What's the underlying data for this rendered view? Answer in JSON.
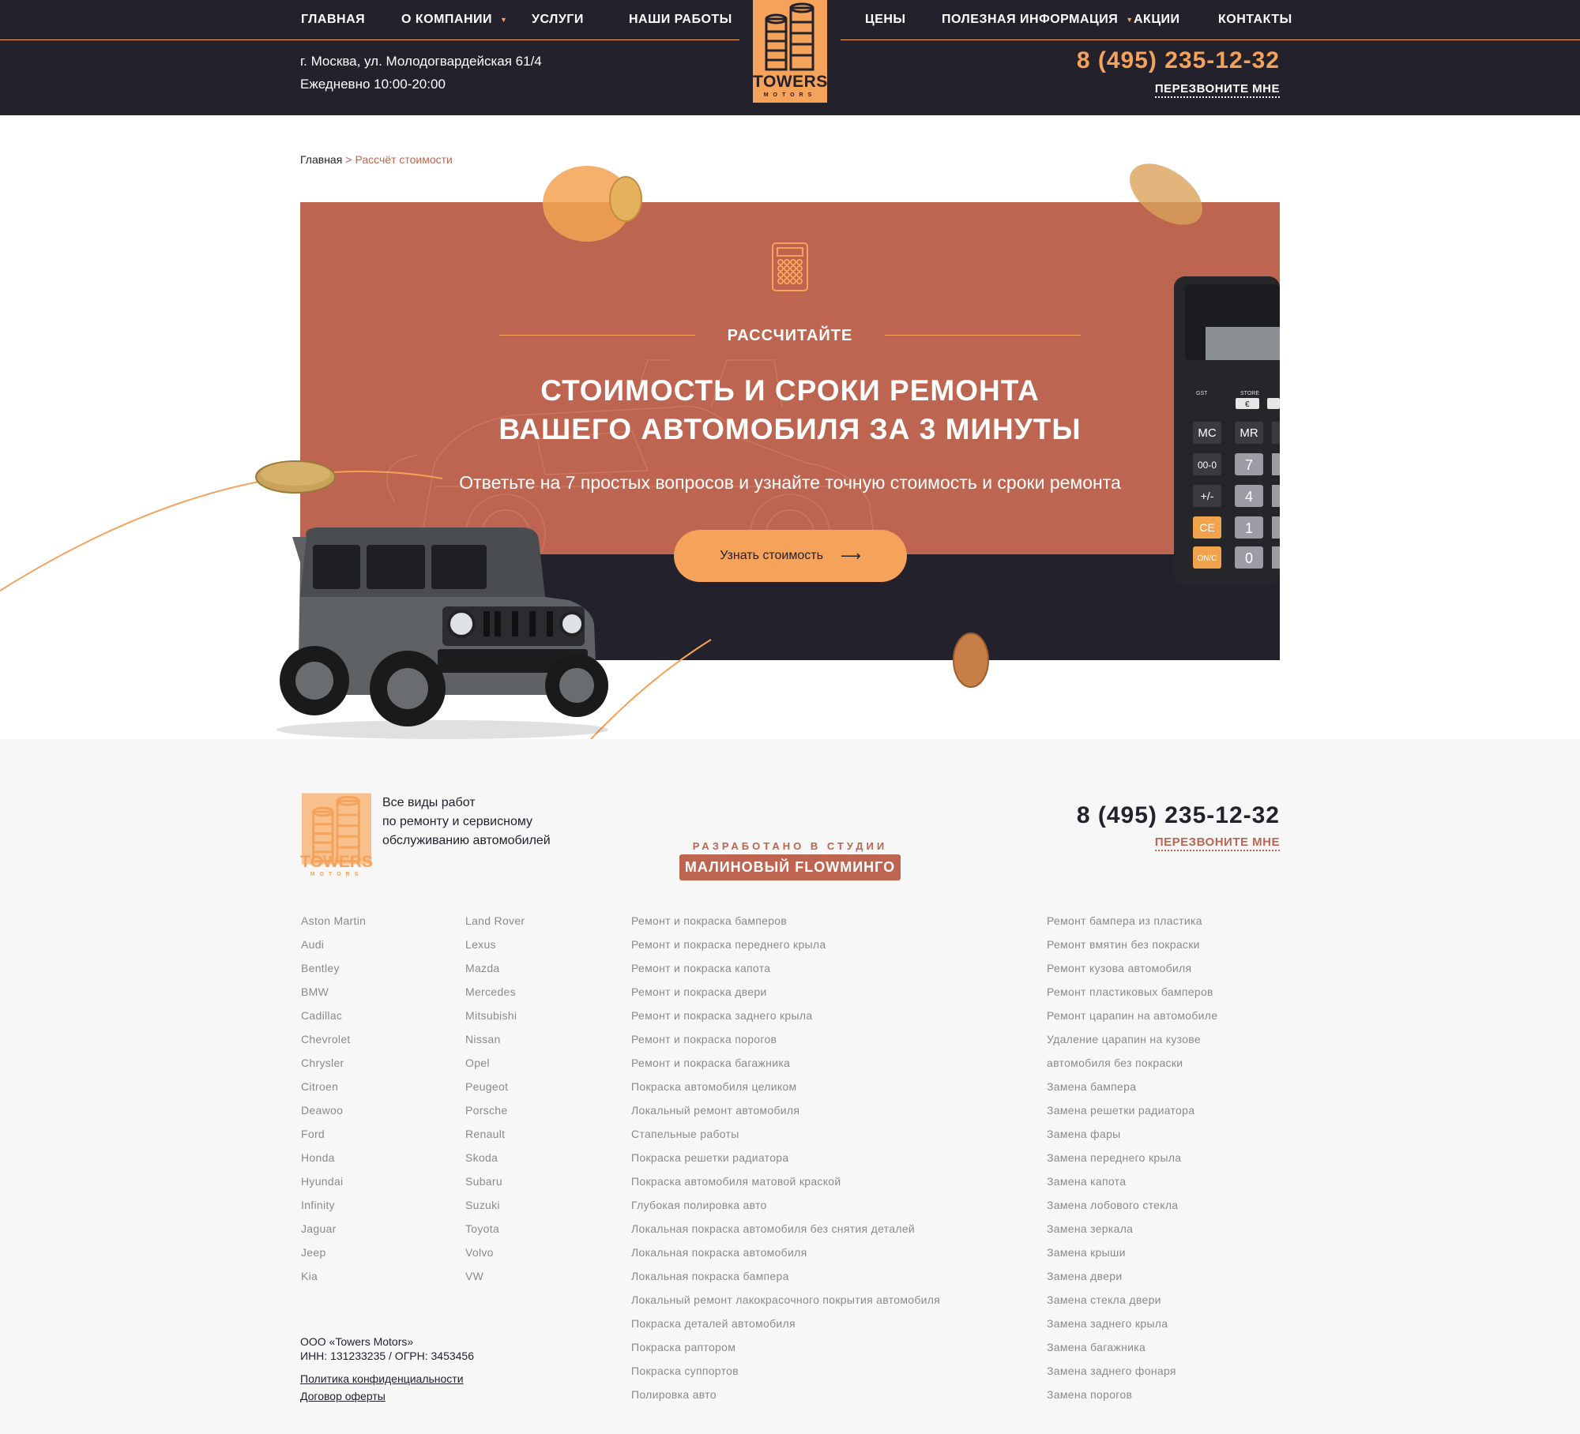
{
  "header": {
    "nav_left": [
      {
        "label": "ГЛАВНАЯ",
        "dropdown": false
      },
      {
        "label": "О КОМПАНИИ",
        "dropdown": true
      },
      {
        "label": "УСЛУГИ",
        "dropdown": false
      },
      {
        "label": "НАШИ РАБОТЫ",
        "dropdown": false
      }
    ],
    "nav_right": [
      {
        "label": "ЦЕНЫ",
        "dropdown": false
      },
      {
        "label": "ПОЛЕЗНАЯ ИНФОРМАЦИЯ",
        "dropdown": true
      },
      {
        "label": "АКЦИИ",
        "dropdown": false
      },
      {
        "label": "КОНТАКТЫ",
        "dropdown": false
      }
    ],
    "logo": {
      "name": "TOWERS",
      "sub": "MOTORS"
    },
    "address": "г. Москва, ул. Молодогвардейская 61/4",
    "hours": "Ежедневно 10:00-20:00",
    "phone": "8 (495) 235-12-32",
    "callback": "ПЕРЕЗВОНИТЕ МНЕ"
  },
  "breadcrumb": {
    "home": "Главная",
    "separator": ">",
    "current": "Рассчёт стоимости"
  },
  "hero": {
    "kicker": "РАССЧИТАЙТЕ",
    "title_line1": "СТОИМОСТЬ И СРОКИ РЕМОНТА",
    "title_line2": "ВАШЕГО АВТОМОБИЛЯ ЗА 3 МИНУТЫ",
    "subtitle": "Ответьте на 7 простых вопросов и узнайте точную стоимость и сроки ремонта",
    "button": "Узнать стоимость",
    "calculator_keys": [
      "MC",
      "MR",
      "00-0",
      "7",
      "+/-",
      "4",
      "CE",
      "1",
      "ON/C",
      "0"
    ],
    "calculator_labels": [
      "STORE",
      "€"
    ]
  },
  "footer": {
    "logo": {
      "name": "TOWERS",
      "sub": "MOTORS"
    },
    "tagline": [
      "Все виды работ",
      "по ремонту и сервисному",
      "обслуживанию автомобилей"
    ],
    "studio_top": "РАЗРАБОТАНО В СТУДИИ",
    "studio_name": "МАЛИНОВЫЙ FLOWМИНГО",
    "phone": "8 (495) 235-12-32",
    "callback": "ПЕРЕЗВОНИТЕ МНЕ",
    "brands_col1": [
      "Aston Martin",
      "Audi",
      "Bentley",
      "BMW",
      "Cadillac",
      "Chevrolet",
      "Chrysler",
      "Citroen",
      "Deawoo",
      "Ford",
      "Honda",
      "Hyundai",
      "Infinity",
      "Jaguar",
      "Jeep",
      "Kia"
    ],
    "brands_col2": [
      "Land Rover",
      "Lexus",
      "Mazda",
      "Mercedes",
      "Mitsubishi",
      "Nissan",
      "Opel",
      "Peugeot",
      "Porsche",
      "Renault",
      "Skoda",
      "Subaru",
      "Suzuki",
      "Toyota",
      "Volvo",
      "VW"
    ],
    "services_col1": [
      "Ремонт и покраска бамперов",
      "Ремонт и покраска переднего крыла",
      "Ремонт и покраска капота",
      "Ремонт и покраска двери",
      "Ремонт и покраска заднего крыла",
      "Ремонт и покраска порогов",
      "Ремонт и покраска багажника",
      "Покраска автомобиля целиком",
      "Локальный ремонт автомобиля",
      "Стапельные работы",
      "Покраска решетки радиатора",
      "Покраска автомобиля матовой краской",
      "Глубокая полировка авто",
      "Локальная покраска автомобиля без снятия деталей",
      "Локальная покраска автомобиля",
      "Локальная покраска бампера",
      "Локальный ремонт лакокрасочного покрытия автомобиля",
      "Покраска деталей автомобиля",
      "Покраска раптором",
      "Покраска суппортов",
      "Полировка авто"
    ],
    "services_col2": [
      "Ремонт бампера из пластика",
      "Ремонт вмятин без покраски",
      "Ремонт кузова автомобиля",
      "Ремонт пластиковых бамперов",
      "Ремонт царапин на автомобиле",
      "Удаление царапин на кузове",
      "автомобиля без покраски",
      "Замена бампера",
      "Замена решетки радиатора",
      "Замена фары",
      "Замена переднего крыла",
      "Замена капота",
      "Замена лобового стекла",
      "Замена зеркала",
      "Замена крыши",
      "Замена двери",
      "Замена стекла двери",
      "Замена заднего крыла",
      "Замена багажника",
      "Замена заднего фонаря",
      "Замена порогов"
    ],
    "company": "ООО «Towers Motors»",
    "requisites": "ИНН: 131233235 / ОГРН: 3453456",
    "privacy": "Политика конфиденциальности",
    "offer": "Договор оферты"
  },
  "colors": {
    "dark": "#23222c",
    "accent": "#f5a25a",
    "terracotta": "#bd6550",
    "footer_bg": "#f7f7f7",
    "muted_text": "#8a8a8a"
  }
}
